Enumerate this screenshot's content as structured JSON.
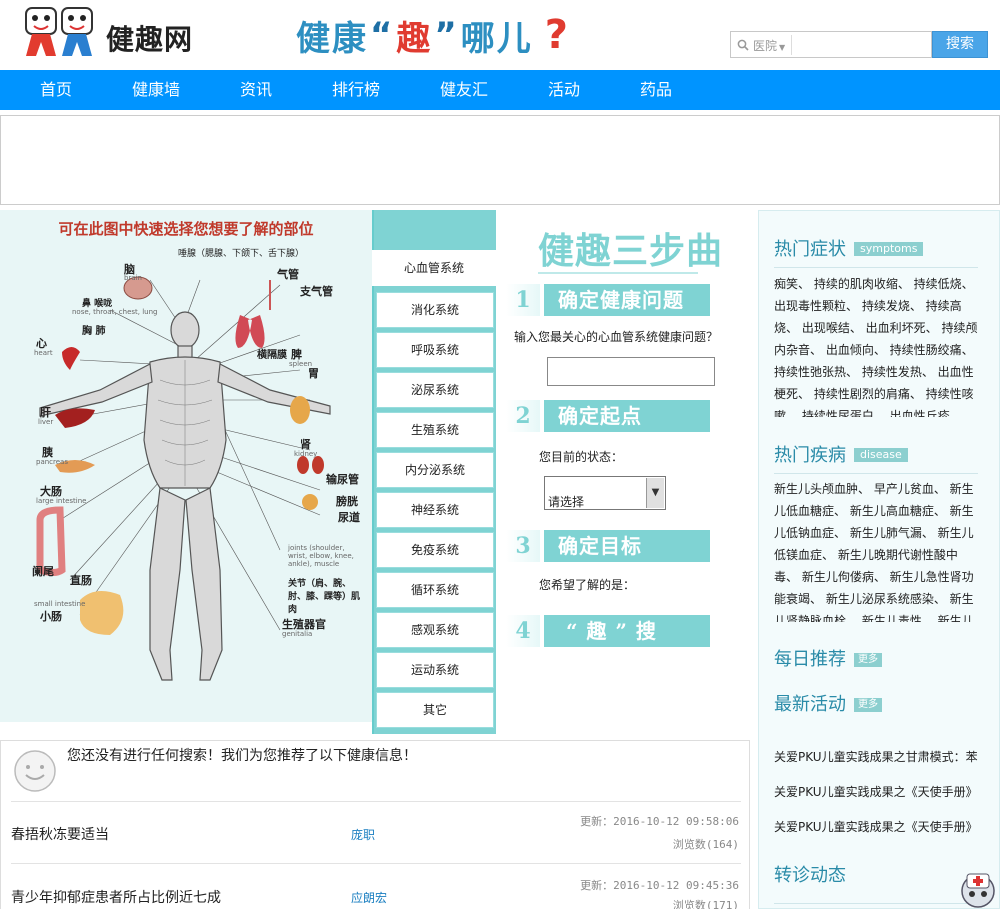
{
  "site": {
    "logo_text": "健趣网",
    "slogan_part1": "健康",
    "slogan_quote_open": "“",
    "slogan_fun": "趣",
    "slogan_quote_close": "”",
    "slogan_part2": "哪儿",
    "slogan_qmark": "?"
  },
  "search": {
    "type": "医院",
    "button": "搜索",
    "value": ""
  },
  "nav": {
    "items": [
      "首页",
      "健康墙",
      "资讯",
      "排行榜",
      "健友汇",
      "活动",
      "药品"
    ]
  },
  "body_map": {
    "title": "可在此图中快速选择您想要了解的部位",
    "labels": {
      "brain": "脑",
      "brain_en": "brain",
      "salivary": "唾腺（腮腺、下颌下、舌下腺）",
      "nose": "鼻 喉咙",
      "nose_en": "nose, throat, chest, lung",
      "chest": "胸 肺",
      "trachea": "气管",
      "bronchi": "支气管",
      "heart": "心",
      "heart_en": "heart",
      "diaphragm": "横隔膜",
      "spleen": "脾",
      "spleen_en": "spleen",
      "stomach": "胃",
      "liver": "肝",
      "liver_en": "liver",
      "pancreas": "胰",
      "pancreas_en": "pancreas",
      "kidney": "肾",
      "kidney_en": "kidney",
      "ureter": "输尿管",
      "bladder": "膀胱",
      "urethra": "尿道",
      "large_intestine": "大肠",
      "large_intestine_en": "large intestine",
      "appendix": "阑尾",
      "rectum": "直肠",
      "small_intestine": "小肠",
      "small_intestine_en": "small intestine",
      "joints": "关节（肩、腕、肘、膝、踝等）肌肉",
      "joints_en": "joints (shoulder, wrist, elbow, knee, ankle), muscle",
      "genitals": "生殖器官",
      "genitals_en": "genitalia"
    }
  },
  "systems": {
    "active": "心血管系统",
    "items": [
      "消化系统",
      "呼吸系统",
      "泌尿系统",
      "生殖系统",
      "内分泌系统",
      "神经系统",
      "免疫系统",
      "循环系统",
      "感观系统",
      "运动系统",
      "其它"
    ]
  },
  "steps": {
    "title": "健趣三步曲",
    "step1": {
      "num": "1",
      "label": "确定健康问题",
      "prompt": "输入您最关心的心血管系统健康问题？",
      "value": ""
    },
    "step2": {
      "num": "2",
      "label": "确定起点",
      "prompt": "您目前的状态：",
      "select_value": "请选择"
    },
    "step3": {
      "num": "3",
      "label": "确定目标",
      "prompt": "您希望了解的是："
    },
    "step4": {
      "num": "4",
      "label": "“ 趣 ” 搜"
    }
  },
  "sidebar": {
    "symptoms": {
      "title": "热门症状",
      "tag": "symptoms",
      "items": [
        "痴笑",
        "持续的肌肉收缩",
        "持续低烧",
        "出现毒性颗粒",
        "持续发烧",
        "持续高烧",
        "出现喉结",
        "出血利坏死",
        "持续颅内杂音",
        "出血倾向",
        "持续性肠绞痛",
        "持续性弛张热",
        "持续性发热",
        "出血性梗死",
        "持续性剧烈的肩痛",
        "持续性咳嗽",
        "持续性尿蛋白",
        "出血性丘疹"
      ]
    },
    "diseases": {
      "title": "热门疾病",
      "tag": "disease",
      "items": [
        "新生儿头颅血肿",
        "早产儿贫血",
        "新生儿低血糖症",
        "新生儿高血糖症",
        "新生儿低钠血症",
        "新生儿肺气漏",
        "新生儿低镁血症",
        "新生儿晚期代谢性酸中毒",
        "新生儿佝偻病",
        "新生儿急性肾功能衰竭",
        "新生儿泌尿系统感染",
        "新生儿肾静脉血栓",
        "新生儿毒性",
        "新生儿"
      ]
    },
    "daily": {
      "title": "每日推荐",
      "more": "更多"
    },
    "activities": {
      "title": "最新活动",
      "more": "更多",
      "items": [
        "关爱PKU儿童实践成果之甘肃模式：苯",
        "关爱PKU儿童实践成果之《天使手册》",
        "关爱PKU儿童实践成果之《天使手册》"
      ]
    },
    "transfer": {
      "title": "转诊动态"
    }
  },
  "recommend": {
    "message": "您还没有进行任何搜索！我们为您推荐了以下健康信息！",
    "items": [
      {
        "title": "春捂秋冻要适当",
        "author": "庞职",
        "updated": "更新：2016-10-12 09:58:06",
        "views": "浏览数(164)"
      },
      {
        "title": "青少年抑郁症患者所占比例近七成",
        "author": "应朗宏",
        "updated": "更新：2016-10-12 09:45:36",
        "views": "浏览数(171)"
      }
    ]
  },
  "colors": {
    "nav": "#0094ff",
    "teal": "#7fd3d3",
    "link": "#1b7fc1",
    "map_bg": "#e8f6f6",
    "map_title": "#c0392b"
  }
}
